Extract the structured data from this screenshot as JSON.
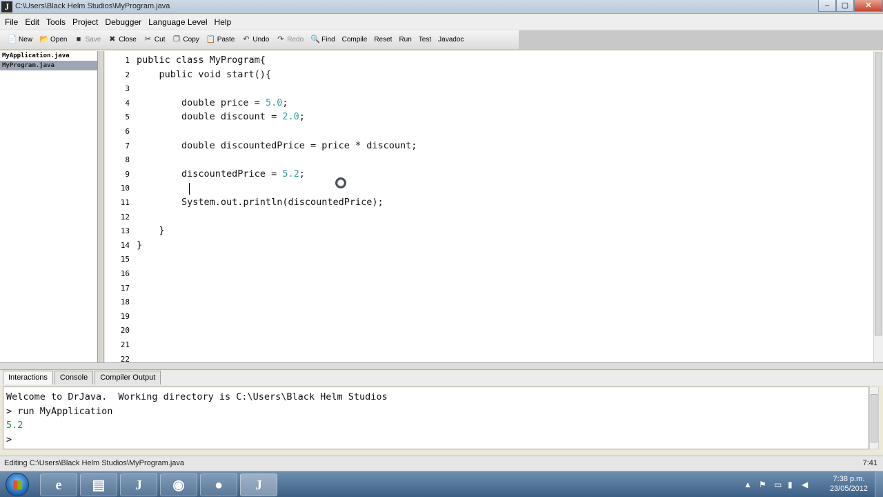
{
  "window": {
    "title": "C:\\Users\\Black Helm Studios\\MyProgram.java",
    "app_icon": "J",
    "buttons": [
      "–",
      "▢",
      "✕"
    ]
  },
  "menubar": [
    "File",
    "Edit",
    "Tools",
    "Project",
    "Debugger",
    "Language Level",
    "Help"
  ],
  "toolbar": [
    {
      "label": "New",
      "icon": "new-file-icon",
      "glyph": "📄",
      "enabled": true
    },
    {
      "label": "Open",
      "icon": "open-folder-icon",
      "glyph": "📂",
      "enabled": true
    },
    {
      "label": "Save",
      "icon": "save-icon",
      "glyph": "■",
      "enabled": false
    },
    {
      "label": "Close",
      "icon": "close-file-icon",
      "glyph": "✖",
      "enabled": true
    },
    {
      "label": "Cut",
      "icon": "scissors-icon",
      "glyph": "✂",
      "enabled": true
    },
    {
      "label": "Copy",
      "icon": "copy-icon",
      "glyph": "❐",
      "enabled": true
    },
    {
      "label": "Paste",
      "icon": "paste-icon",
      "glyph": "📋",
      "enabled": true
    },
    {
      "label": "Undo",
      "icon": "undo-icon",
      "glyph": "↶",
      "enabled": true
    },
    {
      "label": "Redo",
      "icon": "redo-icon",
      "glyph": "↷",
      "enabled": false
    },
    {
      "label": "Find",
      "icon": "binoculars-icon",
      "glyph": "🔍",
      "enabled": true
    },
    {
      "label": "Compile",
      "icon": "",
      "glyph": "",
      "enabled": true
    },
    {
      "label": "Reset",
      "icon": "",
      "glyph": "",
      "enabled": true
    },
    {
      "label": "Run",
      "icon": "",
      "glyph": "",
      "enabled": true
    },
    {
      "label": "Test",
      "icon": "",
      "glyph": "",
      "enabled": true
    },
    {
      "label": "Javadoc",
      "icon": "",
      "glyph": "",
      "enabled": true
    }
  ],
  "files": [
    {
      "name": "MyApplication.java",
      "selected": false
    },
    {
      "name": "MyProgram.java",
      "selected": true
    }
  ],
  "editor": {
    "lines": [
      "public class MyProgram{",
      "    public void start(){",
      "",
      "        double price = 5.0;",
      "        double discount = 2.0;",
      "",
      "        double discountedPrice = price * discount;",
      "",
      "        discountedPrice = 5.2;",
      "",
      "        System.out.println(discountedPrice);",
      "",
      "    }",
      "}",
      "",
      "",
      "",
      "",
      "",
      "",
      "",
      ""
    ],
    "line_count": 22
  },
  "bottom_tabs": [
    {
      "label": "Interactions",
      "active": true
    },
    {
      "label": "Console",
      "active": false
    },
    {
      "label": "Compiler Output",
      "active": false
    }
  ],
  "interactions": [
    {
      "text": "Welcome to DrJava.  Working directory is C:\\Users\\Black Helm Studios",
      "type": "normal"
    },
    {
      "text": "> run MyApplication",
      "type": "normal"
    },
    {
      "text": "5.2",
      "type": "result"
    },
    {
      "text": ">",
      "type": "normal"
    }
  ],
  "status": {
    "text": "Editing C:\\Users\\Black Helm Studios\\MyProgram.java",
    "position": "7:41"
  },
  "taskbar": {
    "apps": [
      {
        "name": "internet-explorer-icon",
        "glyph": "e"
      },
      {
        "name": "file-explorer-icon",
        "glyph": "▤"
      },
      {
        "name": "drjava-icon",
        "glyph": "J"
      },
      {
        "name": "camera-icon",
        "glyph": "◉"
      },
      {
        "name": "firefox-icon",
        "glyph": "●"
      },
      {
        "name": "drjava-active-icon",
        "glyph": "J"
      }
    ],
    "clock_time": "7:38 p.m.",
    "clock_date": "23/05/2012"
  }
}
